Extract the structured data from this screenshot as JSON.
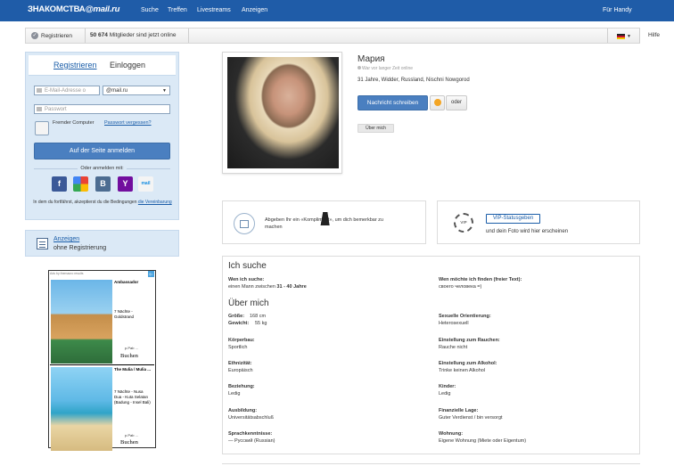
{
  "topbar": {
    "logo_main": "ЗНАКОМСТВА",
    "logo_mail": "@mail.ru",
    "nav": [
      "Suche",
      "Treffen",
      "Livestreams",
      "Anzeigen"
    ],
    "right_link": "Für Handy"
  },
  "statusbar": {
    "registered": "Registrieren",
    "members_count": "50 674",
    "members_text": "Mitglieder sind jetzt online",
    "help": "Hilfe"
  },
  "login": {
    "tab_register": "Registrieren",
    "tab_login": "Einloggen",
    "email_placeholder": "E-Mail-Adresse o",
    "domain_value": "@mail.ru",
    "password_placeholder": "Passwort",
    "remember": "Fremder Computer",
    "forgot": "Passwort vergessen?",
    "submit": "Auf der Seite anmelden",
    "or_login_with": "Oder anmelden mit:",
    "social": [
      "facebook",
      "google",
      "vk",
      "yahoo",
      "mailru"
    ],
    "terms_prefix": "In dem du fortfährst, akzeptierst du die Bedingungen ",
    "terms_link": "die Vereinbarung"
  },
  "anon": {
    "link": "Anzeigen",
    "text": "ohne Registrierung"
  },
  "ad": {
    "header": "Ads by themacro results",
    "badge": "i▷",
    "items": [
      {
        "title": "Ambassador",
        "text1": "7 Nächte -",
        "text2": "Goldstrand",
        "price": "p.Pab ...",
        "book": "Buchen"
      },
      {
        "title": "The Mulia / Mulia ...",
        "text1": "7 Nächte - Nusa",
        "text2": "Dua - Kuta Selatan (Badung - Insel Bali)",
        "price": "p.Pab ...",
        "book": "Buchen"
      }
    ]
  },
  "profile": {
    "name": "Мария",
    "online_status": "War vor langer Zeit online",
    "info": "31 Jahre, Widder, Russland, Nischni Nowgorod",
    "message_button": "Nachricht schreiben",
    "or_button": "oder",
    "about_chip": "Über mich"
  },
  "gift": {
    "text": "Abgeben Ihr ein «Kompliment», um dich bemerkbar zu machen"
  },
  "vip": {
    "icon_label": "VIP",
    "button": "VIP-Statusgeben",
    "text": "und dein Foto wird hier erscheinen"
  },
  "details": {
    "search_title": "Ich suche",
    "whom_label": "Wen ich suche:",
    "whom_value_prefix": "einen Mann zwischen ",
    "whom_value_age": "31 - 40 Jahre",
    "free_label": "Wen möchte ich finden (freier Text):",
    "free_value": "своего человека =)",
    "about_title": "Über mich",
    "size_label": "Größe:",
    "size_value": "168 cm",
    "weight_label": "Gewicht:",
    "weight_value": "55 kg",
    "orientation_label": "Sexuelle Orientierung:",
    "orientation_value": "Heterosexuell",
    "body_label": "Körperbau:",
    "body_value": "Sportlich",
    "smoking_label": "Einstellung zum Rauchen:",
    "smoking_value": "Rauche nicht",
    "ethnicity_label": "Ethnizität:",
    "ethnicity_value": "Europäisch",
    "alcohol_label": "Einstellung zum Alkohol:",
    "alcohol_value": "Trinke keinen Alkohol",
    "relationship_label": "Beziehung:",
    "relationship_value": "Ledig",
    "children_label": "Kinder:",
    "children_value": "Ledig",
    "education_label": "Ausbildung:",
    "education_value": "Universitätsabschluß",
    "finance_label": "Finanzielle Lage:",
    "finance_value": "Guter Verdienst / bin versorgt",
    "languages_label": "Sprachkenntnisse:",
    "languages_value": "— Русский (Russian)",
    "housing_label": "Wohnung:",
    "housing_value": "Eigene Wohnung (Miete oder Eigentum)"
  }
}
